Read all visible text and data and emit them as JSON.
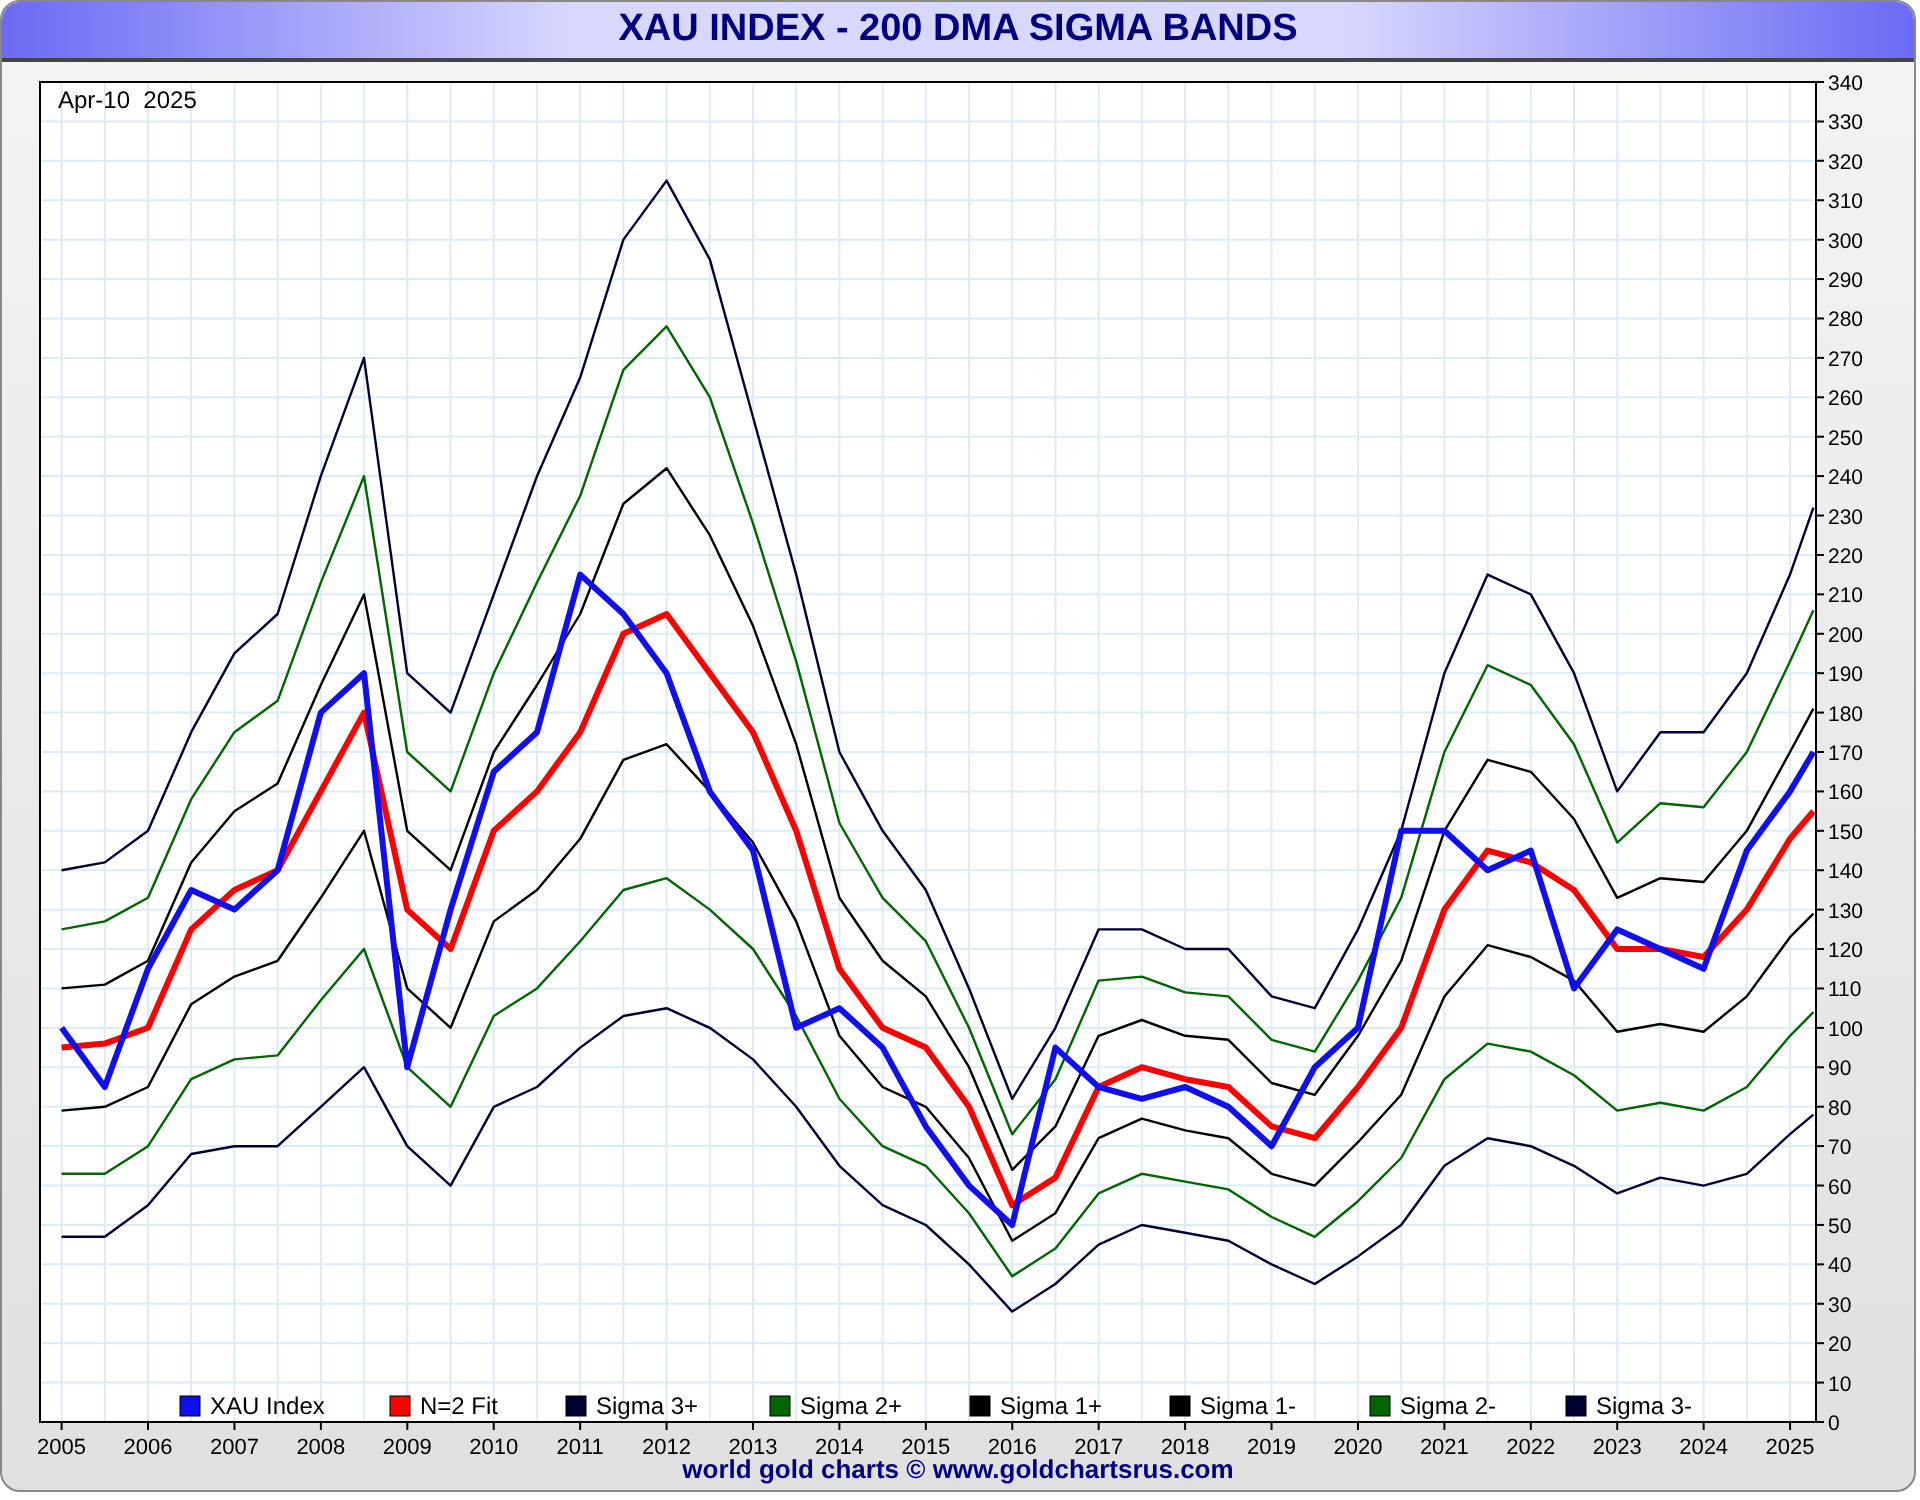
{
  "window": {
    "title": "XAU INDEX - 200 DMA SIGMA BANDS"
  },
  "chart": {
    "date_label": "Apr-10  2025",
    "chart_data": {
      "type": "line",
      "grid": true,
      "legend": true,
      "xlim": [
        2004.75,
        2025.3
      ],
      "ylim": [
        0,
        340
      ],
      "xticks": [
        2005,
        2006,
        2007,
        2008,
        2009,
        2010,
        2011,
        2012,
        2013,
        2014,
        2015,
        2016,
        2017,
        2018,
        2019,
        2020,
        2021,
        2022,
        2023,
        2024,
        2025
      ],
      "yticks": [
        0,
        10,
        20,
        30,
        40,
        50,
        60,
        70,
        80,
        90,
        100,
        110,
        120,
        130,
        140,
        150,
        160,
        170,
        180,
        190,
        200,
        210,
        220,
        230,
        240,
        250,
        260,
        270,
        280,
        290,
        300,
        310,
        320,
        330,
        340
      ],
      "x": [
        2005,
        2005.5,
        2006,
        2006.5,
        2007,
        2007.5,
        2008,
        2008.5,
        2009,
        2009.5,
        2010,
        2010.5,
        2011,
        2011.5,
        2012,
        2012.5,
        2013,
        2013.5,
        2014,
        2014.5,
        2015,
        2015.5,
        2016,
        2016.5,
        2017,
        2017.5,
        2018,
        2018.5,
        2019,
        2019.5,
        2020,
        2020.5,
        2021,
        2021.5,
        2022,
        2022.5,
        2023,
        2023.5,
        2024,
        2024.5,
        2025,
        2025.27
      ],
      "series": [
        {
          "name": "XAU Index",
          "color": "#1010ee",
          "values": [
            100,
            85,
            115,
            135,
            130,
            140,
            180,
            190,
            90,
            130,
            165,
            175,
            215,
            205,
            190,
            160,
            145,
            100,
            105,
            95,
            75,
            60,
            50,
            95,
            85,
            82,
            85,
            80,
            70,
            90,
            100,
            150,
            150,
            140,
            145,
            110,
            125,
            120,
            115,
            145,
            160,
            170
          ]
        },
        {
          "name": "N=2 Fit",
          "color": "#ff0000",
          "values": [
            95,
            96,
            100,
            125,
            135,
            140,
            160,
            180,
            130,
            120,
            150,
            160,
            175,
            200,
            205,
            190,
            175,
            150,
            115,
            100,
            95,
            80,
            55,
            62,
            85,
            90,
            87,
            85,
            75,
            72,
            85,
            100,
            130,
            145,
            142,
            135,
            120,
            120,
            118,
            130,
            148,
            155
          ]
        },
        {
          "name": "Sigma 3+",
          "color": "#000033",
          "values": [
            140,
            142,
            150,
            175,
            195,
            205,
            240,
            270,
            190,
            180,
            210,
            240,
            265,
            300,
            315,
            295,
            255,
            215,
            170,
            150,
            135,
            110,
            82,
            100,
            125,
            125,
            120,
            120,
            108,
            105,
            125,
            150,
            190,
            215,
            210,
            190,
            160,
            175,
            175,
            190,
            215,
            232
          ]
        },
        {
          "name": "Sigma 2+",
          "color": "#006600",
          "values": [
            125,
            127,
            133,
            158,
            175,
            183,
            213,
            240,
            170,
            160,
            190,
            213,
            235,
            267,
            278,
            260,
            228,
            193,
            152,
            133,
            122,
            100,
            73,
            87,
            112,
            113,
            109,
            108,
            97,
            94,
            112,
            133,
            170,
            192,
            187,
            172,
            147,
            157,
            156,
            170,
            193,
            206
          ]
        },
        {
          "name": "Sigma 1+",
          "color": "#000000",
          "values": [
            110,
            111,
            117,
            142,
            155,
            162,
            187,
            210,
            150,
            140,
            170,
            187,
            205,
            233,
            242,
            225,
            202,
            172,
            133,
            117,
            108,
            90,
            64,
            75,
            98,
            102,
            98,
            97,
            86,
            83,
            98,
            117,
            150,
            168,
            165,
            153,
            133,
            138,
            137,
            150,
            170,
            181
          ]
        },
        {
          "name": "Sigma 1-",
          "color": "#000000",
          "values": [
            79,
            80,
            85,
            106,
            113,
            117,
            133,
            150,
            110,
            100,
            127,
            135,
            148,
            168,
            172,
            160,
            147,
            127,
            98,
            85,
            80,
            67,
            46,
            53,
            72,
            77,
            74,
            72,
            63,
            60,
            71,
            83,
            108,
            121,
            118,
            112,
            99,
            101,
            99,
            108,
            123,
            129
          ]
        },
        {
          "name": "Sigma 2-",
          "color": "#006600",
          "values": [
            63,
            63,
            70,
            87,
            92,
            93,
            107,
            120,
            90,
            80,
            103,
            110,
            122,
            135,
            138,
            130,
            120,
            103,
            82,
            70,
            65,
            53,
            37,
            44,
            58,
            63,
            61,
            59,
            52,
            47,
            56,
            67,
            87,
            96,
            94,
            88,
            79,
            81,
            79,
            85,
            98,
            104
          ]
        },
        {
          "name": "Sigma 3-",
          "color": "#000033",
          "values": [
            47,
            47,
            55,
            68,
            70,
            70,
            80,
            90,
            70,
            60,
            80,
            85,
            95,
            103,
            105,
            100,
            92,
            80,
            65,
            55,
            50,
            40,
            28,
            35,
            45,
            50,
            48,
            46,
            40,
            35,
            42,
            50,
            65,
            72,
            70,
            65,
            58,
            62,
            60,
            63,
            73,
            78
          ]
        }
      ]
    }
  },
  "footer": "world gold charts © www.goldchartsrus.com"
}
